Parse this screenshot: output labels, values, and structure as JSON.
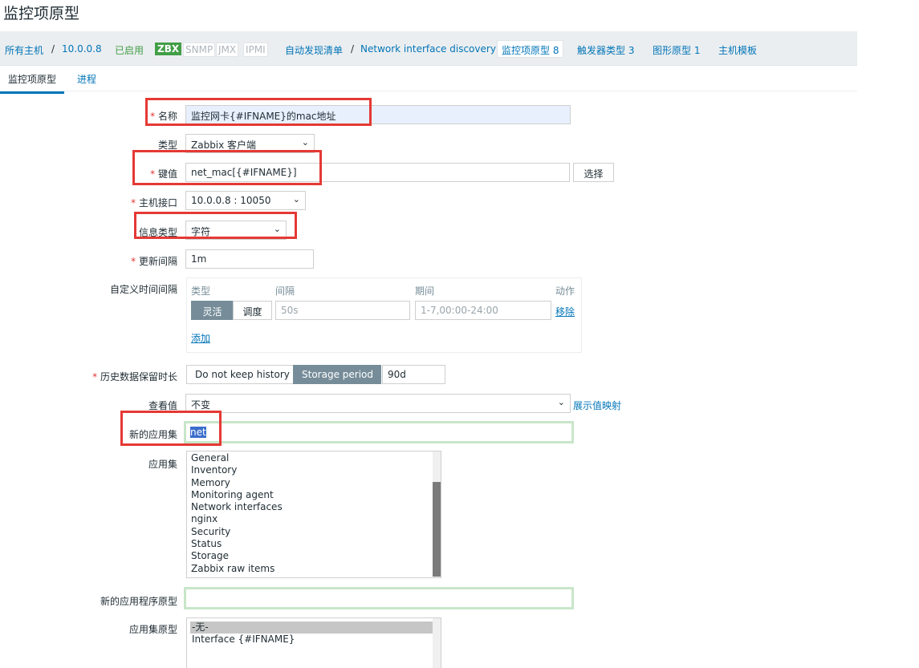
{
  "page_title": "监控项原型",
  "breadcrumb": {
    "all_hosts": "所有主机",
    "sep1": "/",
    "host": "10.0.0.8",
    "enabled": "已启用",
    "zbx": "ZBX",
    "snmp": "SNMP",
    "jmx": "JMX",
    "ipmi": "IPMI",
    "discovery_list": "自动发现清单",
    "sep2": "/",
    "discovery_rule": "Network interface discovery",
    "item_prototypes": "监控项原型 8",
    "trigger_prototypes": "触发器类型 3",
    "graph_prototypes": "图形原型 1",
    "host_templates": "主机模板"
  },
  "tabs": {
    "item_prototype": "监控项原型",
    "process": "进程"
  },
  "form": {
    "required_mark": "*",
    "name_label": "名称",
    "name_value": "监控网卡{#IFNAME}的mac地址",
    "type_label": "类型",
    "type_value": "Zabbix 客户端",
    "key_label": "键值",
    "key_value": "net_mac[{#IFNAME}]",
    "select_btn": "选择",
    "host_iface_label": "主机接口",
    "host_iface_value": "10.0.0.8 : 10050",
    "info_type_label": "信息类型",
    "info_type_value": "字符",
    "update_interval_label": "更新间隔",
    "update_interval_value": "1m",
    "custom_intervals_label": "自定义时间间隔",
    "sched": {
      "col_type": "类型",
      "col_interval": "间隔",
      "col_period": "期间",
      "col_action": "动作",
      "flexible": "灵活",
      "scheduling": "调度",
      "interval_placeholder": "50s",
      "period_placeholder": "1-7,00:00-24:00",
      "remove": "移除",
      "add": "添加"
    },
    "history_label": "历史数据保留时长",
    "history_no_keep": "Do not keep history",
    "history_storage": "Storage period",
    "history_value": "90d",
    "show_value_label": "查看值",
    "show_value_value": "不变",
    "show_value_map": "展示值映射",
    "new_app_label": "新的应用集",
    "new_app_value": "net",
    "apps_label": "应用集",
    "apps": [
      "General",
      "Inventory",
      "Memory",
      "Monitoring agent",
      "Network interfaces",
      "nginx",
      "Security",
      "Status",
      "Storage",
      "Zabbix raw items"
    ],
    "new_app_proto_label": "新的应用程序原型",
    "new_app_proto_value": "",
    "app_protos_label": "应用集原型",
    "app_protos": [
      "-无-",
      "Interface {#IFNAME}"
    ]
  },
  "colors": {
    "link": "#0275b8",
    "enabled": "#429e47",
    "required": "#e33734",
    "annotation_red": "#e53935",
    "button_active": "#768d99"
  }
}
